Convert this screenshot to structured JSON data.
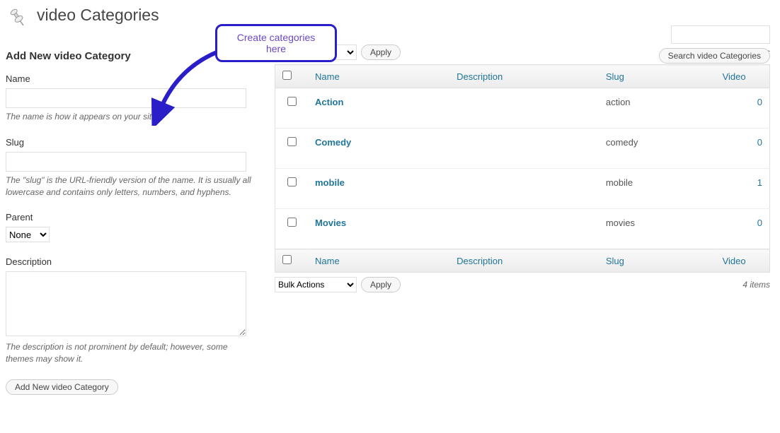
{
  "page_title": "video Categories",
  "callout_text": "Create categories here",
  "search": {
    "button": "Search video Categories"
  },
  "form": {
    "heading": "Add New video Category",
    "name_label": "Name",
    "name_help": "The name is how it appears on your site.",
    "slug_label": "Slug",
    "slug_help": "The \"slug\" is the URL-friendly version of the name. It is usually all lowercase and contains only letters, numbers, and hyphens.",
    "parent_label": "Parent",
    "parent_selected": "None",
    "desc_label": "Description",
    "desc_help": "The description is not prominent by default; however, some themes may show it.",
    "submit": "Add New video Category"
  },
  "bulk": {
    "label": "Bulk Actions",
    "apply": "Apply"
  },
  "items_count": "4 items",
  "columns": {
    "name": "Name",
    "description": "Description",
    "slug": "Slug",
    "video": "Video"
  },
  "rows": [
    {
      "name": "Action",
      "desc": "",
      "slug": "action",
      "video": "0"
    },
    {
      "name": "Comedy",
      "desc": "",
      "slug": "comedy",
      "video": "0"
    },
    {
      "name": "mobile",
      "desc": "",
      "slug": "mobile",
      "video": "1"
    },
    {
      "name": "Movies",
      "desc": "",
      "slug": "movies",
      "video": "0"
    }
  ]
}
